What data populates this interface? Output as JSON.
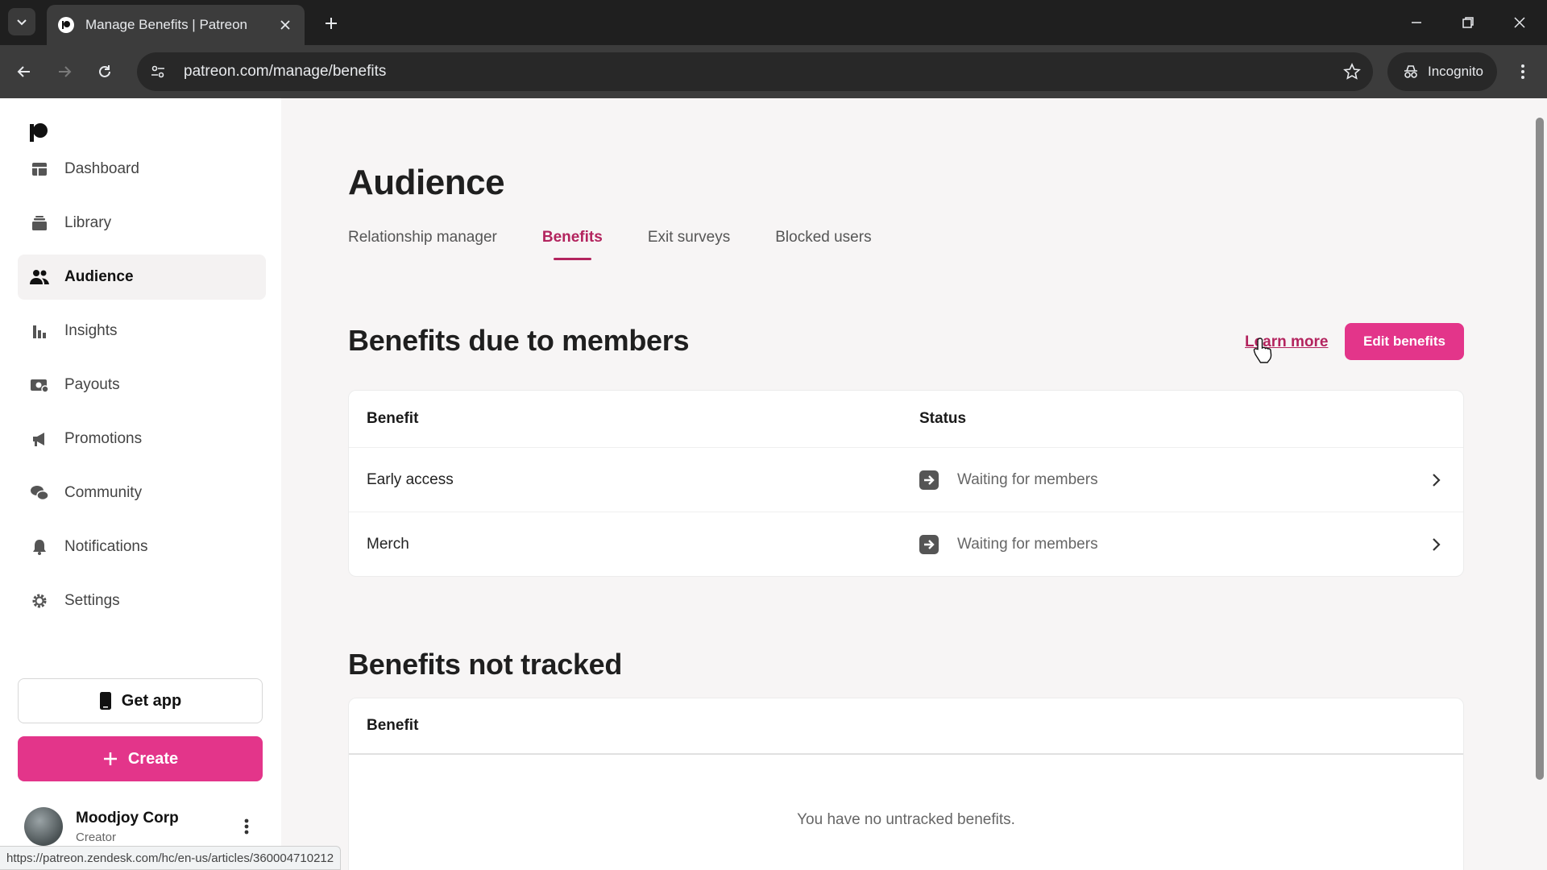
{
  "browser": {
    "tab_title": "Manage Benefits | Patreon",
    "url": "patreon.com/manage/benefits",
    "incognito_label": "Incognito",
    "status_url": "https://patreon.zendesk.com/hc/en-us/articles/360004710212"
  },
  "sidebar": {
    "items": [
      {
        "label": "Dashboard",
        "icon": "dashboard-icon"
      },
      {
        "label": "Library",
        "icon": "library-icon"
      },
      {
        "label": "Audience",
        "icon": "audience-icon",
        "active": true
      },
      {
        "label": "Insights",
        "icon": "insights-icon"
      },
      {
        "label": "Payouts",
        "icon": "payouts-icon"
      },
      {
        "label": "Promotions",
        "icon": "megaphone-icon"
      },
      {
        "label": "Community",
        "icon": "chat-icon"
      },
      {
        "label": "Notifications",
        "icon": "bell-icon"
      },
      {
        "label": "Settings",
        "icon": "gear-icon"
      }
    ],
    "get_app_label": "Get app",
    "create_label": "Create",
    "profile": {
      "name": "Moodjoy Corp",
      "role": "Creator"
    }
  },
  "main": {
    "title": "Audience",
    "tabs": [
      {
        "label": "Relationship manager"
      },
      {
        "label": "Benefits",
        "active": true
      },
      {
        "label": "Exit surveys"
      },
      {
        "label": "Blocked users"
      }
    ],
    "due": {
      "title": "Benefits due to members",
      "learn_more": "Learn more",
      "edit_label": "Edit benefits",
      "col_benefit": "Benefit",
      "col_status": "Status",
      "rows": [
        {
          "benefit": "Early access",
          "status": "Waiting for members"
        },
        {
          "benefit": "Merch",
          "status": "Waiting for members"
        }
      ]
    },
    "not_tracked": {
      "title": "Benefits not tracked",
      "col_benefit": "Benefit",
      "empty": "You have no untracked benefits."
    }
  },
  "colors": {
    "accent": "#e3358a",
    "tab_active": "#b3245e"
  }
}
